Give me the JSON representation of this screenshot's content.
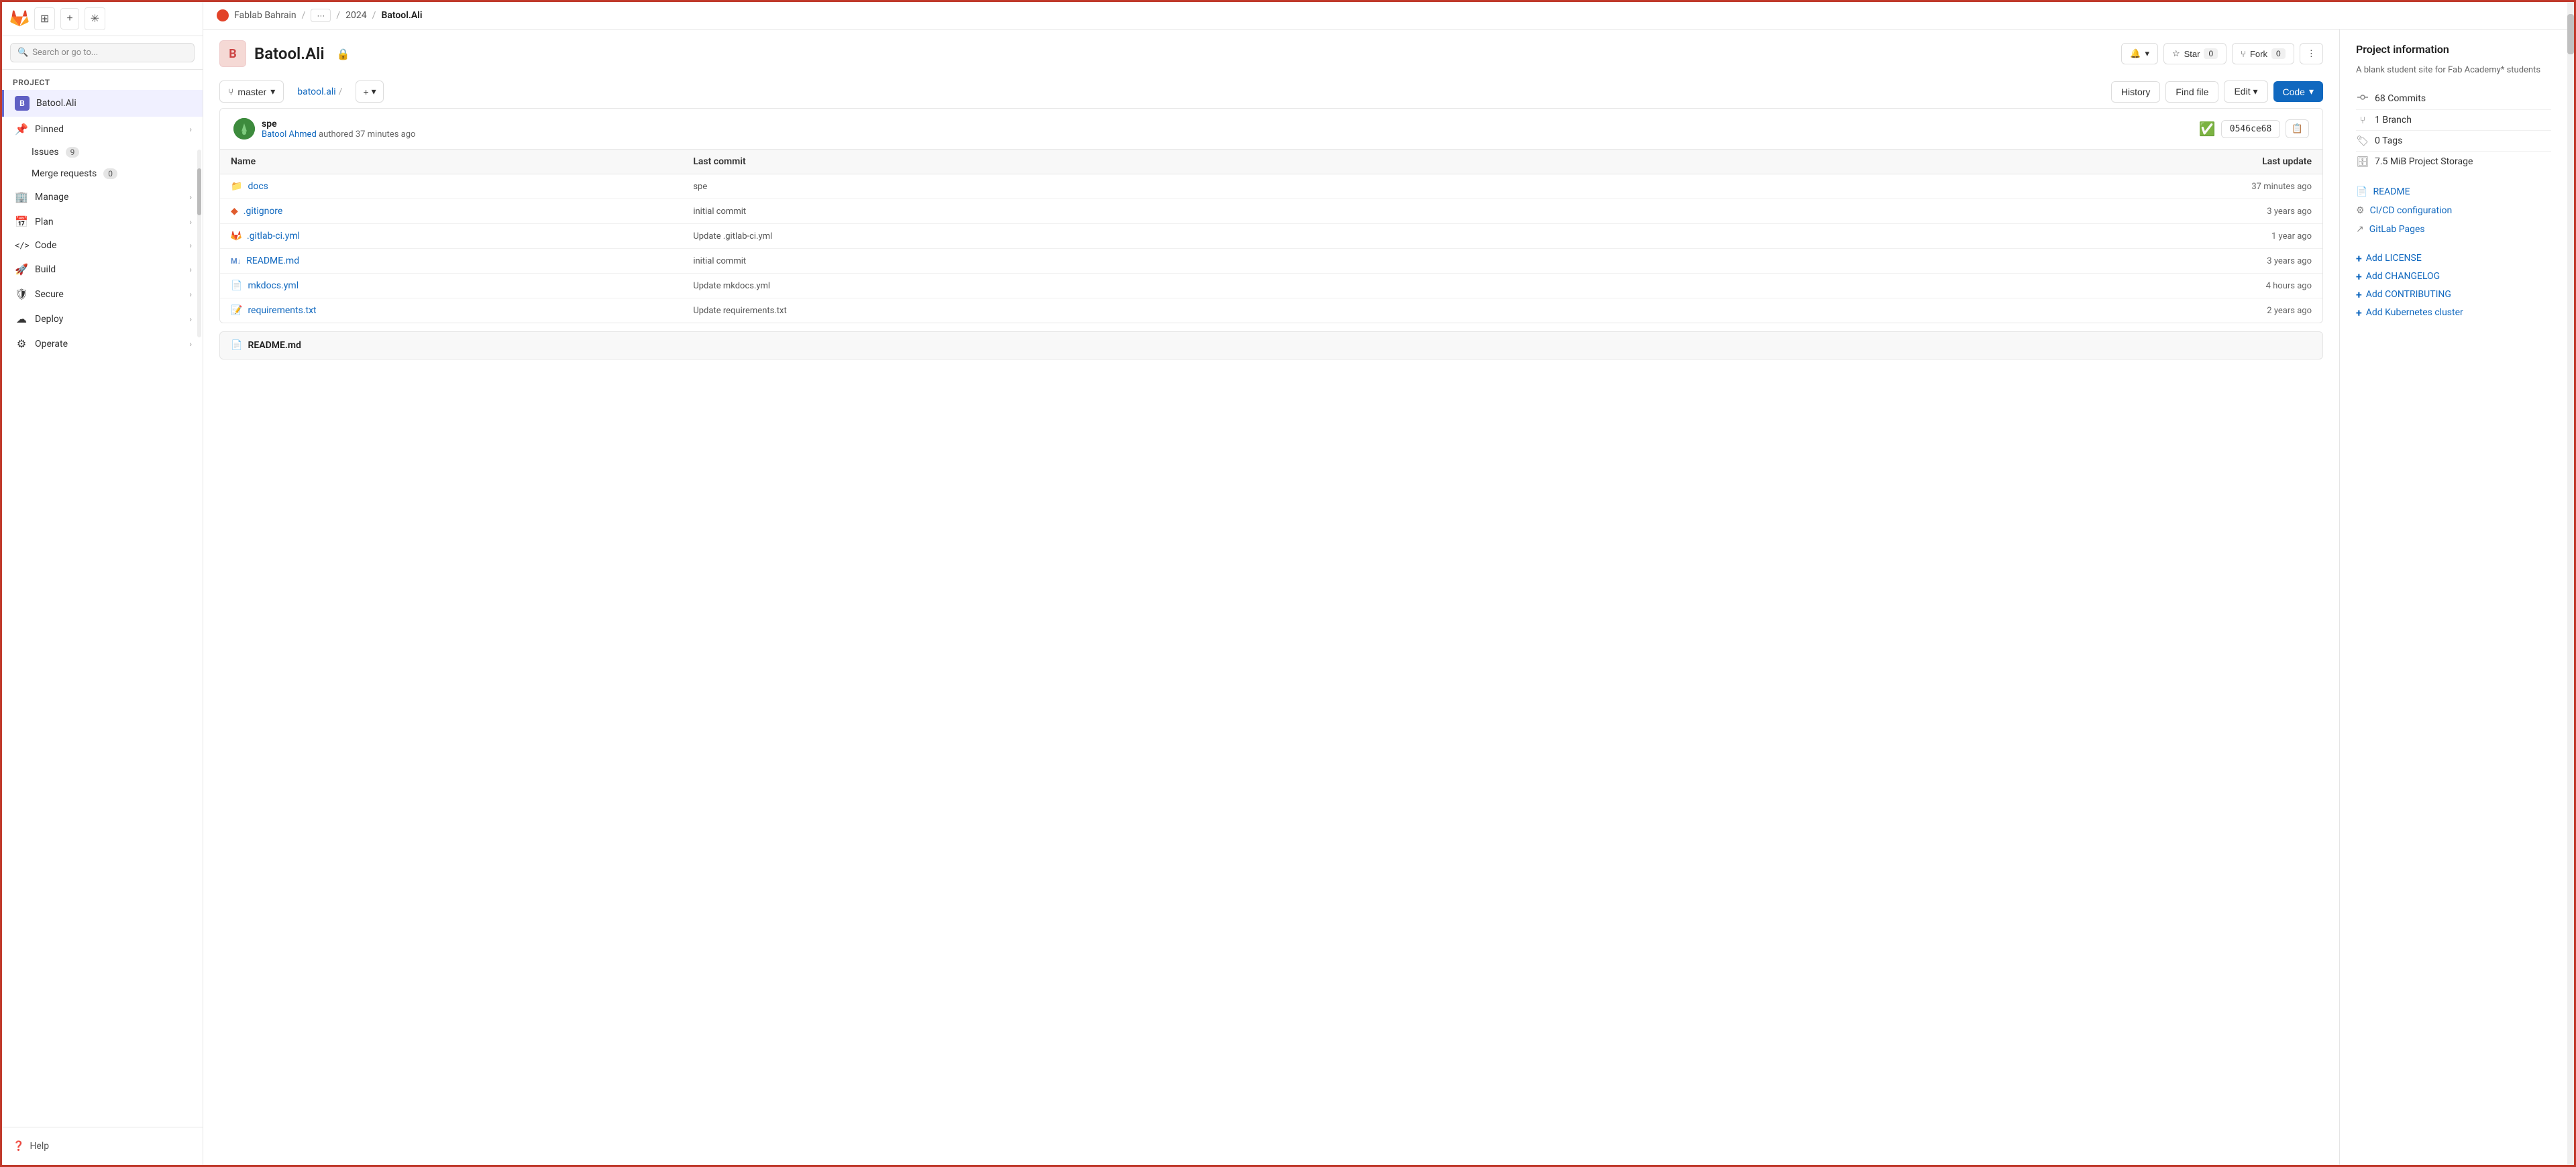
{
  "sidebar": {
    "project_label": "Project",
    "project_name": "Batool.Ali",
    "search_placeholder": "Search or go to...",
    "nav_items": [
      {
        "id": "pinned",
        "label": "Pinned",
        "icon": "📌",
        "hasChevron": true
      },
      {
        "id": "issues",
        "label": "Issues",
        "icon": "◎",
        "badge": "9"
      },
      {
        "id": "merge-requests",
        "label": "Merge requests",
        "icon": "⑂",
        "badge": "0"
      },
      {
        "id": "manage",
        "label": "Manage",
        "icon": "🏢",
        "hasChevron": true
      },
      {
        "id": "plan",
        "label": "Plan",
        "icon": "📅",
        "hasChevron": true
      },
      {
        "id": "code",
        "label": "Code",
        "icon": "</>",
        "hasChevron": true
      },
      {
        "id": "build",
        "label": "Build",
        "icon": "🚀",
        "hasChevron": true
      },
      {
        "id": "secure",
        "label": "Secure",
        "icon": "🛡",
        "hasChevron": true
      },
      {
        "id": "deploy",
        "label": "Deploy",
        "icon": "☁",
        "hasChevron": true
      },
      {
        "id": "operate",
        "label": "Operate",
        "icon": "⚙",
        "hasChevron": true
      }
    ],
    "help_label": "Help"
  },
  "breadcrumb": {
    "org": "Fablab Bahrain",
    "sep1": "/",
    "year": "2024",
    "sep2": "/",
    "project": "Batool.Ali",
    "more_label": "···"
  },
  "repo": {
    "avatar_letter": "B",
    "title": "Batool.Ali",
    "lock_icon": "🔒",
    "actions": {
      "star_label": "Star",
      "star_count": "0",
      "fork_label": "Fork",
      "fork_count": "0"
    }
  },
  "file_toolbar": {
    "branch_icon": "⑂",
    "branch_name": "master",
    "path_parts": [
      "batool.ali",
      "/"
    ],
    "add_label": "+",
    "history_label": "History",
    "find_file_label": "Find file",
    "edit_label": "Edit",
    "edit_chevron": "▾",
    "code_label": "Code",
    "code_chevron": "▾"
  },
  "commit": {
    "message": "spe",
    "author": "Batool Ahmed",
    "author_suffix": "authored 37 minutes ago",
    "hash": "0546ce68",
    "copy_tooltip": "Copy"
  },
  "file_table": {
    "columns": [
      "Name",
      "Last commit",
      "Last update"
    ],
    "rows": [
      {
        "name": "docs",
        "icon": "folder",
        "commit": "spe",
        "date": "37 minutes ago"
      },
      {
        "name": ".gitignore",
        "icon": "gitignore",
        "commit": "initial commit",
        "date": "3 years ago"
      },
      {
        "name": ".gitlab-ci.yml",
        "icon": "gitlab",
        "commit": "Update .gitlab-ci.yml",
        "date": "1 year ago"
      },
      {
        "name": "README.md",
        "icon": "markdown",
        "commit": "initial commit",
        "date": "3 years ago"
      },
      {
        "name": "mkdocs.yml",
        "icon": "yaml",
        "commit": "Update mkdocs.yml",
        "date": "4 hours ago"
      },
      {
        "name": "requirements.txt",
        "icon": "text",
        "commit": "Update requirements.txt",
        "date": "2 years ago"
      }
    ]
  },
  "readme_bar": {
    "icon": "📄",
    "label": "README.md"
  },
  "right_sidebar": {
    "title": "Project information",
    "description": "A blank student site for Fab Academy* students",
    "stats": [
      {
        "icon": "○○",
        "label": "68 Commits"
      },
      {
        "icon": "⑂",
        "label": "1 Branch"
      },
      {
        "icon": "🏷",
        "label": "0 Tags"
      },
      {
        "icon": "🗄",
        "label": "7.5 MiB Project Storage"
      }
    ],
    "links": [
      {
        "icon": "📄",
        "label": "README"
      },
      {
        "icon": "⚙",
        "label": "CI/CD configuration"
      },
      {
        "icon": "↗",
        "label": "GitLab Pages"
      }
    ],
    "add_links": [
      {
        "label": "Add LICENSE"
      },
      {
        "label": "Add CHANGELOG"
      },
      {
        "label": "Add CONTRIBUTING"
      },
      {
        "label": "Add Kubernetes cluster"
      }
    ]
  }
}
